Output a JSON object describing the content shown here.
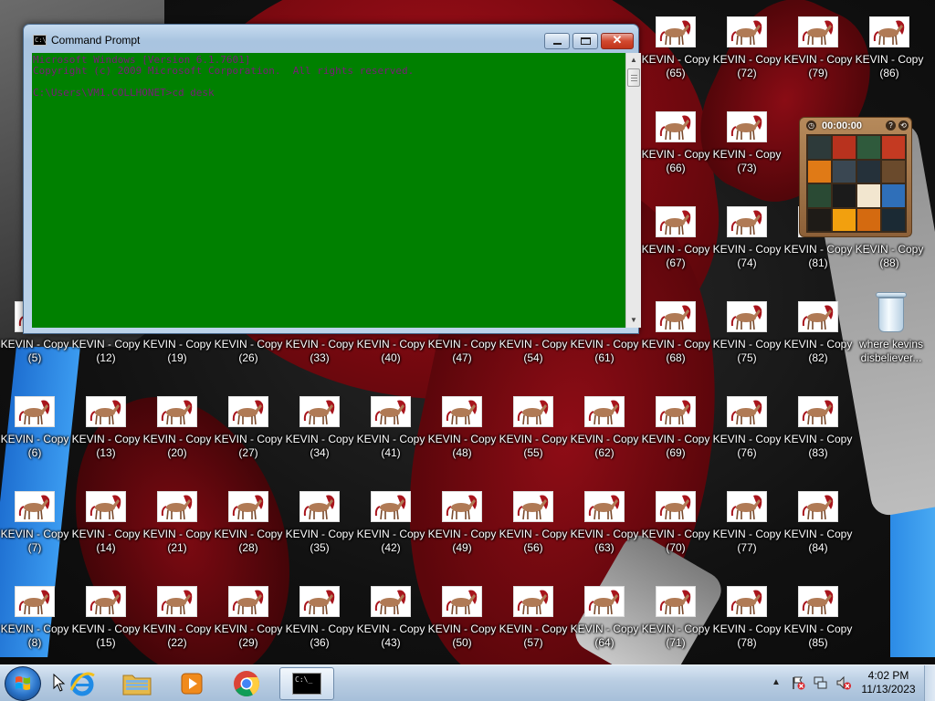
{
  "desktop": {
    "icon_label": "KEVIN - Copy",
    "columns": [
      {
        "index": [
          null,
          null,
          null,
          5,
          6,
          7,
          8
        ]
      },
      {
        "index": [
          null,
          null,
          null,
          12,
          13,
          14,
          15
        ]
      },
      {
        "index": [
          null,
          null,
          null,
          19,
          20,
          21,
          22
        ]
      },
      {
        "index": [
          null,
          null,
          null,
          26,
          27,
          28,
          29
        ]
      },
      {
        "index": [
          null,
          null,
          null,
          33,
          34,
          35,
          36
        ]
      },
      {
        "index": [
          null,
          null,
          null,
          40,
          41,
          42,
          43
        ]
      },
      {
        "index": [
          null,
          null,
          null,
          47,
          48,
          49,
          50
        ]
      },
      {
        "index": [
          null,
          null,
          null,
          54,
          55,
          56,
          57
        ]
      },
      {
        "index": [
          null,
          null,
          null,
          61,
          62,
          63,
          64
        ]
      },
      {
        "index": [
          65,
          66,
          67,
          68,
          69,
          70,
          71
        ]
      },
      {
        "index": [
          72,
          73,
          74,
          75,
          76,
          77,
          78
        ]
      },
      {
        "index": [
          79,
          null,
          81,
          82,
          83,
          84,
          85
        ]
      },
      {
        "index": [
          86,
          null,
          88,
          null,
          null,
          null,
          null
        ]
      }
    ],
    "recycle_bin": {
      "label": "where kevins\ndisbeliever..."
    }
  },
  "cmd": {
    "title": "Command Prompt",
    "lines": [
      "Microsoft Windows [Version 6.1.7601]",
      "Copyright (c) 2009 Microsoft Corporation.  All rights reserved.",
      "",
      "C:\\Users\\VM1.COLLHONET>cd desk"
    ],
    "console_bg": "#008000",
    "console_fg": "#7b1a7a",
    "buttons": {
      "close_glyph": "✕"
    }
  },
  "puzzle_gadget": {
    "timer": "00:00:00",
    "help_glyph": "?",
    "tile_colors": [
      "#2d3a3a",
      "#b8321e",
      "#2f5a3c",
      "#c43a22",
      "#e07a16",
      "#3a4752",
      "#25313a",
      "#6a4a2c",
      "#2a4a34",
      "#1b1b1b",
      "#f2e6cf",
      "#2f6fb9",
      "#1e1b17",
      "#f2a00e",
      "#d46a10",
      "#1b2a34"
    ]
  },
  "taskbar": {
    "apps": [
      {
        "name": "Internet Explorer"
      },
      {
        "name": "Windows Explorer"
      },
      {
        "name": "Windows Media Player"
      },
      {
        "name": "Google Chrome"
      },
      {
        "name": "Command Prompt",
        "active": true,
        "glyph": "C:\\_"
      }
    ],
    "clock": {
      "time": "4:02 PM",
      "date": "11/13/2023"
    },
    "tray_arrow": "▲"
  }
}
